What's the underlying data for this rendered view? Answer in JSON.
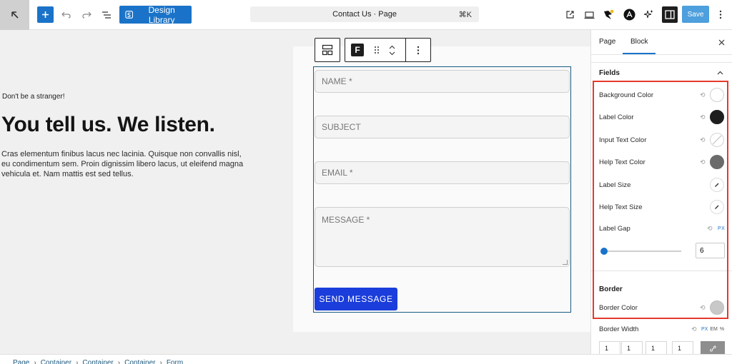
{
  "topbar": {
    "design_library_label": "Design Library",
    "page_title": "Contact Us · Page",
    "shortcut": "⌘K",
    "save_label": "Save"
  },
  "hero": {
    "tagline": "Don't be a stranger!",
    "title": "You tell us. We listen.",
    "body": "Cras elementum finibus lacus nec lacinia. Quisque non convallis nisl, eu condimentum sem. Proin dignissim libero lacus, ut eleifend magna vehicula et. Nam mattis est sed tellus."
  },
  "form": {
    "name_placeholder": "NAME *",
    "subject_placeholder": "SUBJECT",
    "email_placeholder": "EMAIL *",
    "message_placeholder": "MESSAGE *",
    "submit_label": "SEND MESSAGE"
  },
  "sidebar": {
    "tabs": [
      {
        "label": "Page",
        "active": false
      },
      {
        "label": "Block",
        "active": true
      }
    ],
    "fields_section": {
      "title": "Fields",
      "rows": [
        {
          "label": "Background Color",
          "swatch": "#ffffff"
        },
        {
          "label": "Label Color",
          "swatch": "#1e1e1e"
        },
        {
          "label": "Input Text Color",
          "swatch": "none"
        },
        {
          "label": "Help Text Color",
          "swatch": "#6b6b6b"
        },
        {
          "label": "Label Size"
        },
        {
          "label": "Help Text Size"
        },
        {
          "label": "Label Gap",
          "unit": "PX"
        }
      ],
      "label_gap_value": "6",
      "label_gap_fraction": 0.04
    },
    "border_section": {
      "title": "Border",
      "border_color_label": "Border Color",
      "border_color_swatch": "#c8c8c8",
      "border_width_label": "Border Width",
      "units": [
        "PX",
        "EM",
        "%"
      ],
      "widths": [
        "1",
        "1",
        "1",
        "1"
      ]
    }
  },
  "breadcrumb": [
    "Page",
    "Container",
    "Container",
    "Container",
    "Form"
  ],
  "colors": {
    "accent": "#1a73c8",
    "submit": "#1a3ddb",
    "highlight": "#e53a2b"
  }
}
